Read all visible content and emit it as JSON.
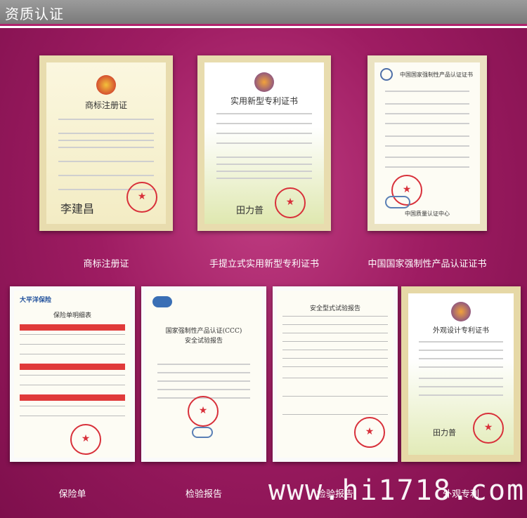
{
  "header": {
    "title": "资质认证"
  },
  "certificates": [
    {
      "caption": "商标注册证",
      "doc_title": "商标注册证",
      "signature": "李建昌"
    },
    {
      "caption": "手提立式实用新型专利证书",
      "doc_title": "实用新型专利证书",
      "signature": "田力普"
    },
    {
      "caption": "中国国家强制性产品认证证书",
      "doc_title": "中国国家强制性产品认证证书",
      "footer": "中国质量认证中心"
    },
    {
      "caption": "保险单",
      "doc_title": "大平洋保险",
      "subtitle": "保险单明细表"
    },
    {
      "caption": "检验报告",
      "doc_title": "国家强制性产品认证(CCC)",
      "subtitle": "安全试验报告"
    },
    {
      "caption": "检验报告",
      "doc_title": "安全型式试验报告"
    },
    {
      "caption": "外观专利",
      "doc_title": "外观设计专利证书",
      "signature": "田力普"
    }
  ],
  "watermark": "www.hi1718.com",
  "colors": {
    "accent": "#b0236d",
    "background": "#9e1c62",
    "header": "#8a8a8a"
  }
}
